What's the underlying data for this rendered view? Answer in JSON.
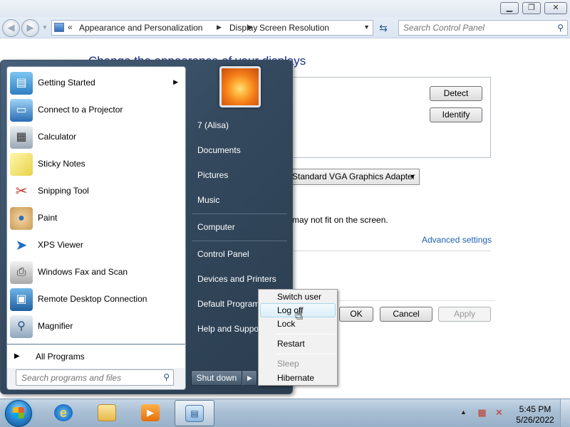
{
  "control_panel": {
    "breadcrumb": [
      "Appearance and Personalization",
      "Display",
      "Screen Resolution"
    ],
    "search_placeholder": "Search Control Panel",
    "heading": "Change the appearance of your displays",
    "buttons": {
      "detect": "Detect",
      "identify": "Identify",
      "ok": "OK",
      "cancel": "Cancel",
      "apply": "Apply"
    },
    "adapter_value": "Standard VGA Graphics Adapter",
    "fit_text": "may not fit on the screen.",
    "advanced_link": "Advanced settings"
  },
  "start_menu": {
    "programs": [
      {
        "label": "Getting Started",
        "icon": "getting-started-icon",
        "has_submenu": true
      },
      {
        "label": "Connect to a Projector",
        "icon": "projector-icon"
      },
      {
        "label": "Calculator",
        "icon": "calculator-icon"
      },
      {
        "label": "Sticky Notes",
        "icon": "sticky-notes-icon"
      },
      {
        "label": "Snipping Tool",
        "icon": "snipping-tool-icon"
      },
      {
        "label": "Paint",
        "icon": "paint-icon"
      },
      {
        "label": "XPS Viewer",
        "icon": "xps-viewer-icon"
      },
      {
        "label": "Windows Fax and Scan",
        "icon": "fax-scan-icon"
      },
      {
        "label": "Remote Desktop Connection",
        "icon": "remote-desktop-icon"
      },
      {
        "label": "Magnifier",
        "icon": "magnifier-icon"
      }
    ],
    "all_programs": "All Programs",
    "search_placeholder": "Search programs and files",
    "right_items": [
      {
        "label": "7 (Alisa)"
      },
      {
        "label": "Documents"
      },
      {
        "label": "Pictures"
      },
      {
        "label": "Music"
      },
      {
        "label": "Computer"
      },
      {
        "label": "Control Panel"
      },
      {
        "label": "Devices and Printers"
      },
      {
        "label": "Default Programs"
      },
      {
        "label": "Help and Support"
      }
    ],
    "shutdown_label": "Shut down"
  },
  "shutdown_menu": [
    {
      "label": "Switch user",
      "state": "normal"
    },
    {
      "label": "Log off",
      "state": "hover"
    },
    {
      "label": "Lock",
      "state": "normal"
    },
    {
      "label": "Restart",
      "state": "normal"
    },
    {
      "label": "Sleep",
      "state": "disabled"
    },
    {
      "label": "Hibernate",
      "state": "normal"
    }
  ],
  "taskbar": {
    "pinned": [
      "internet-explorer-icon",
      "windows-explorer-icon",
      "media-player-icon",
      "control-panel-icon"
    ],
    "time": "5:45 PM",
    "date": "5/26/2022"
  }
}
